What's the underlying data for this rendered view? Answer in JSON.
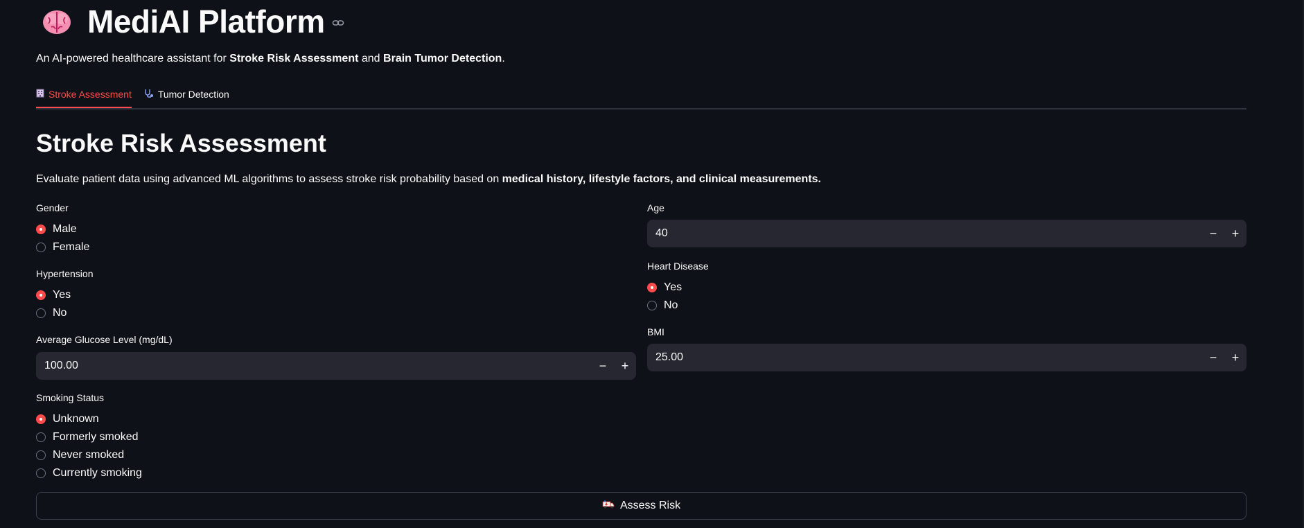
{
  "app": {
    "title": "MediAI Platform",
    "icon": "brain-icon"
  },
  "subtitle": {
    "prefix": "An AI-powered healthcare assistant for ",
    "bold1": "Stroke Risk Assessment",
    "middle": " and ",
    "bold2": "Brain Tumor Detection",
    "suffix": "."
  },
  "tabs": [
    {
      "label": "Stroke Assessment",
      "icon": "building-icon",
      "active": true
    },
    {
      "label": "Tumor Detection",
      "icon": "stethoscope-icon",
      "active": false
    }
  ],
  "section": {
    "title": "Stroke Risk Assessment",
    "desc_prefix": "Evaluate patient data using advanced ML algorithms to assess stroke risk probability based on ",
    "desc_bold": "medical history, lifestyle factors, and clinical measurements."
  },
  "form": {
    "gender": {
      "label": "Gender",
      "options": [
        "Male",
        "Female"
      ],
      "selected": "Male"
    },
    "age": {
      "label": "Age",
      "value": "40",
      "minus": "−",
      "plus": "+"
    },
    "hypertension": {
      "label": "Hypertension",
      "options": [
        "Yes",
        "No"
      ],
      "selected": "Yes"
    },
    "heart_disease": {
      "label": "Heart Disease",
      "options": [
        "Yes",
        "No"
      ],
      "selected": "Yes"
    },
    "glucose": {
      "label": "Average Glucose Level (mg/dL)",
      "value": "100.00",
      "minus": "−",
      "plus": "+"
    },
    "bmi": {
      "label": "BMI",
      "value": "25.00",
      "minus": "−",
      "plus": "+"
    },
    "smoking": {
      "label": "Smoking Status",
      "options": [
        "Unknown",
        "Formerly smoked",
        "Never smoked",
        "Currently smoking"
      ],
      "selected": "Unknown"
    }
  },
  "button": {
    "label": "Assess Risk",
    "icon": "ambulance-icon"
  },
  "colors": {
    "background": "#0e1117",
    "accent": "#ff4b4b",
    "input_bg": "#262730"
  }
}
